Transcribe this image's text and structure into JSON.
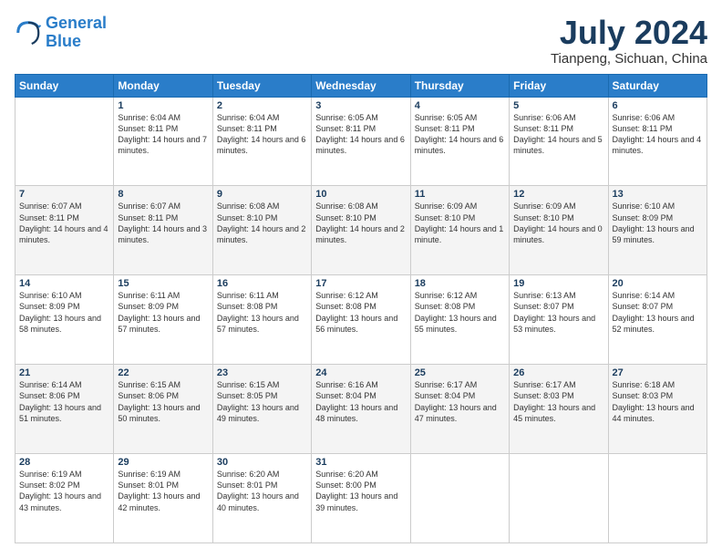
{
  "logo": {
    "line1": "General",
    "line2": "Blue"
  },
  "title": {
    "month": "July 2024",
    "location": "Tianpeng, Sichuan, China"
  },
  "weekdays": [
    "Sunday",
    "Monday",
    "Tuesday",
    "Wednesday",
    "Thursday",
    "Friday",
    "Saturday"
  ],
  "weeks": [
    [
      {
        "day": "",
        "sunrise": "",
        "sunset": "",
        "daylight": ""
      },
      {
        "day": "1",
        "sunrise": "Sunrise: 6:04 AM",
        "sunset": "Sunset: 8:11 PM",
        "daylight": "Daylight: 14 hours and 7 minutes."
      },
      {
        "day": "2",
        "sunrise": "Sunrise: 6:04 AM",
        "sunset": "Sunset: 8:11 PM",
        "daylight": "Daylight: 14 hours and 6 minutes."
      },
      {
        "day": "3",
        "sunrise": "Sunrise: 6:05 AM",
        "sunset": "Sunset: 8:11 PM",
        "daylight": "Daylight: 14 hours and 6 minutes."
      },
      {
        "day": "4",
        "sunrise": "Sunrise: 6:05 AM",
        "sunset": "Sunset: 8:11 PM",
        "daylight": "Daylight: 14 hours and 6 minutes."
      },
      {
        "day": "5",
        "sunrise": "Sunrise: 6:06 AM",
        "sunset": "Sunset: 8:11 PM",
        "daylight": "Daylight: 14 hours and 5 minutes."
      },
      {
        "day": "6",
        "sunrise": "Sunrise: 6:06 AM",
        "sunset": "Sunset: 8:11 PM",
        "daylight": "Daylight: 14 hours and 4 minutes."
      }
    ],
    [
      {
        "day": "7",
        "sunrise": "Sunrise: 6:07 AM",
        "sunset": "Sunset: 8:11 PM",
        "daylight": "Daylight: 14 hours and 4 minutes."
      },
      {
        "day": "8",
        "sunrise": "Sunrise: 6:07 AM",
        "sunset": "Sunset: 8:11 PM",
        "daylight": "Daylight: 14 hours and 3 minutes."
      },
      {
        "day": "9",
        "sunrise": "Sunrise: 6:08 AM",
        "sunset": "Sunset: 8:10 PM",
        "daylight": "Daylight: 14 hours and 2 minutes."
      },
      {
        "day": "10",
        "sunrise": "Sunrise: 6:08 AM",
        "sunset": "Sunset: 8:10 PM",
        "daylight": "Daylight: 14 hours and 2 minutes."
      },
      {
        "day": "11",
        "sunrise": "Sunrise: 6:09 AM",
        "sunset": "Sunset: 8:10 PM",
        "daylight": "Daylight: 14 hours and 1 minute."
      },
      {
        "day": "12",
        "sunrise": "Sunrise: 6:09 AM",
        "sunset": "Sunset: 8:10 PM",
        "daylight": "Daylight: 14 hours and 0 minutes."
      },
      {
        "day": "13",
        "sunrise": "Sunrise: 6:10 AM",
        "sunset": "Sunset: 8:09 PM",
        "daylight": "Daylight: 13 hours and 59 minutes."
      }
    ],
    [
      {
        "day": "14",
        "sunrise": "Sunrise: 6:10 AM",
        "sunset": "Sunset: 8:09 PM",
        "daylight": "Daylight: 13 hours and 58 minutes."
      },
      {
        "day": "15",
        "sunrise": "Sunrise: 6:11 AM",
        "sunset": "Sunset: 8:09 PM",
        "daylight": "Daylight: 13 hours and 57 minutes."
      },
      {
        "day": "16",
        "sunrise": "Sunrise: 6:11 AM",
        "sunset": "Sunset: 8:08 PM",
        "daylight": "Daylight: 13 hours and 57 minutes."
      },
      {
        "day": "17",
        "sunrise": "Sunrise: 6:12 AM",
        "sunset": "Sunset: 8:08 PM",
        "daylight": "Daylight: 13 hours and 56 minutes."
      },
      {
        "day": "18",
        "sunrise": "Sunrise: 6:12 AM",
        "sunset": "Sunset: 8:08 PM",
        "daylight": "Daylight: 13 hours and 55 minutes."
      },
      {
        "day": "19",
        "sunrise": "Sunrise: 6:13 AM",
        "sunset": "Sunset: 8:07 PM",
        "daylight": "Daylight: 13 hours and 53 minutes."
      },
      {
        "day": "20",
        "sunrise": "Sunrise: 6:14 AM",
        "sunset": "Sunset: 8:07 PM",
        "daylight": "Daylight: 13 hours and 52 minutes."
      }
    ],
    [
      {
        "day": "21",
        "sunrise": "Sunrise: 6:14 AM",
        "sunset": "Sunset: 8:06 PM",
        "daylight": "Daylight: 13 hours and 51 minutes."
      },
      {
        "day": "22",
        "sunrise": "Sunrise: 6:15 AM",
        "sunset": "Sunset: 8:06 PM",
        "daylight": "Daylight: 13 hours and 50 minutes."
      },
      {
        "day": "23",
        "sunrise": "Sunrise: 6:15 AM",
        "sunset": "Sunset: 8:05 PM",
        "daylight": "Daylight: 13 hours and 49 minutes."
      },
      {
        "day": "24",
        "sunrise": "Sunrise: 6:16 AM",
        "sunset": "Sunset: 8:04 PM",
        "daylight": "Daylight: 13 hours and 48 minutes."
      },
      {
        "day": "25",
        "sunrise": "Sunrise: 6:17 AM",
        "sunset": "Sunset: 8:04 PM",
        "daylight": "Daylight: 13 hours and 47 minutes."
      },
      {
        "day": "26",
        "sunrise": "Sunrise: 6:17 AM",
        "sunset": "Sunset: 8:03 PM",
        "daylight": "Daylight: 13 hours and 45 minutes."
      },
      {
        "day": "27",
        "sunrise": "Sunrise: 6:18 AM",
        "sunset": "Sunset: 8:03 PM",
        "daylight": "Daylight: 13 hours and 44 minutes."
      }
    ],
    [
      {
        "day": "28",
        "sunrise": "Sunrise: 6:19 AM",
        "sunset": "Sunset: 8:02 PM",
        "daylight": "Daylight: 13 hours and 43 minutes."
      },
      {
        "day": "29",
        "sunrise": "Sunrise: 6:19 AM",
        "sunset": "Sunset: 8:01 PM",
        "daylight": "Daylight: 13 hours and 42 minutes."
      },
      {
        "day": "30",
        "sunrise": "Sunrise: 6:20 AM",
        "sunset": "Sunset: 8:01 PM",
        "daylight": "Daylight: 13 hours and 40 minutes."
      },
      {
        "day": "31",
        "sunrise": "Sunrise: 6:20 AM",
        "sunset": "Sunset: 8:00 PM",
        "daylight": "Daylight: 13 hours and 39 minutes."
      },
      {
        "day": "",
        "sunrise": "",
        "sunset": "",
        "daylight": ""
      },
      {
        "day": "",
        "sunrise": "",
        "sunset": "",
        "daylight": ""
      },
      {
        "day": "",
        "sunrise": "",
        "sunset": "",
        "daylight": ""
      }
    ]
  ]
}
